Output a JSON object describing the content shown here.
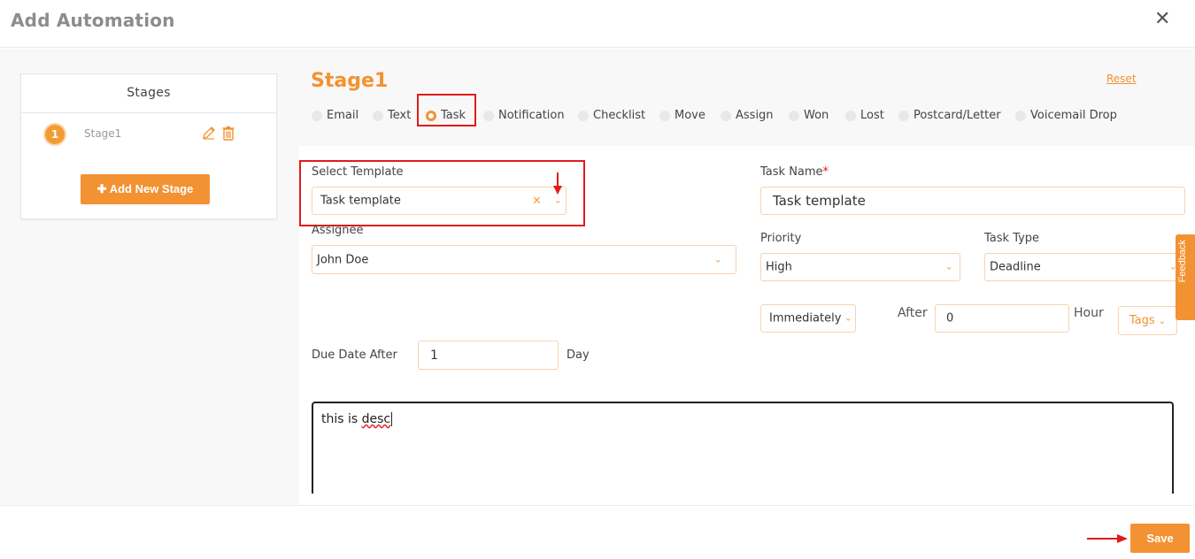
{
  "header": {
    "title": "Add Automation",
    "close_symbol": "✕"
  },
  "stages": {
    "heading": "Stages",
    "items": [
      {
        "number": "1",
        "name": "Stage1"
      }
    ],
    "add_button": "✚ Add New Stage"
  },
  "stage_title": "Stage1",
  "reset_label": "Reset",
  "action_types": [
    {
      "label": "Email",
      "checked": false
    },
    {
      "label": "Text",
      "checked": false
    },
    {
      "label": "Task",
      "checked": true
    },
    {
      "label": "Notification",
      "checked": false
    },
    {
      "label": "Checklist",
      "checked": false
    },
    {
      "label": "Move",
      "checked": false
    },
    {
      "label": "Assign",
      "checked": false
    },
    {
      "label": "Won",
      "checked": false
    },
    {
      "label": "Lost",
      "checked": false
    },
    {
      "label": "Postcard/Letter",
      "checked": false
    },
    {
      "label": "Voicemail Drop",
      "checked": false
    }
  ],
  "form": {
    "select_template": {
      "label": "Select Template",
      "value": "Task template",
      "clear": "×"
    },
    "task_name": {
      "label": "Task Name",
      "required_mark": "*",
      "value": "Task template"
    },
    "assignee": {
      "label": "Assignee",
      "value": "John Doe"
    },
    "priority": {
      "label": "Priority",
      "value": "High"
    },
    "task_type": {
      "label": "Task Type",
      "value": "Deadline"
    },
    "timing": {
      "value": "Immediately",
      "after_label": "After",
      "after_value": "0",
      "unit_label": "Hour"
    },
    "tags_label": "Tags",
    "due_date": {
      "label": "Due Date After",
      "value": "1",
      "unit": "Day"
    },
    "description": {
      "text_plain": "this is ",
      "text_marked": "desc"
    }
  },
  "feedback_label": "Feedback",
  "footer": {
    "save_label": "Save"
  },
  "colors": {
    "accent": "#f39232",
    "highlight": "#e01b1b"
  }
}
